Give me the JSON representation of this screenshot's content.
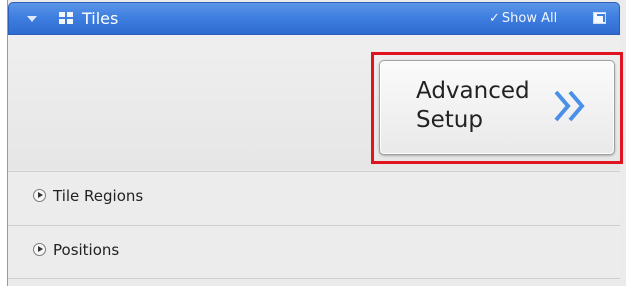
{
  "panel": {
    "title": "Tiles",
    "show_all_label": "Show All",
    "icons": {
      "collapse": "collapse-arrow-icon",
      "tiles": "tiles-grid-icon",
      "check": "checkmark-icon",
      "popout": "popout-window-icon"
    }
  },
  "advanced_button": {
    "line1": "Advanced",
    "line2": "Setup",
    "icon": "double-chevron-right-icon",
    "highlight_color": "#e0141e"
  },
  "sections": [
    {
      "label": "Tile Regions"
    },
    {
      "label": "Positions"
    }
  ],
  "colors": {
    "titlebar": "#3f7fe0",
    "chevron": "#4a90e8",
    "highlight": "#e0141e"
  }
}
